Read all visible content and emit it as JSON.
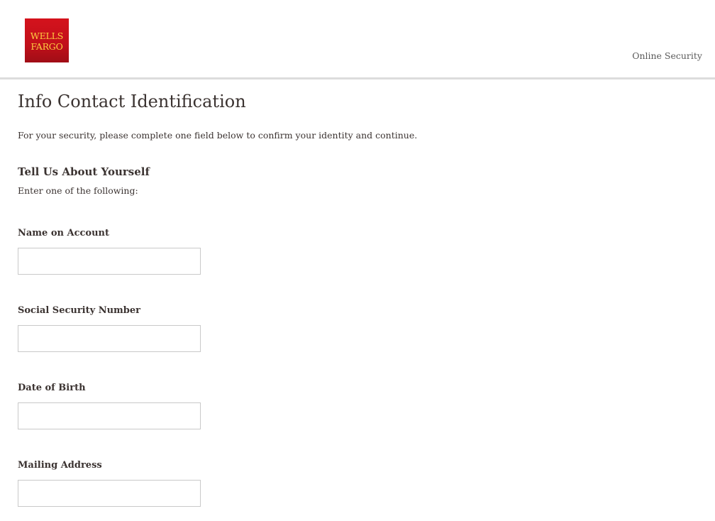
{
  "header": {
    "logo_line1": "WELLS",
    "logo_line2": "FARGO",
    "nav_link": "Online Security"
  },
  "page": {
    "title": "Info Contact Identification",
    "intro": "For your security, please complete one field below to confirm your identity and continue."
  },
  "section": {
    "heading": "Tell Us About Yourself",
    "subheading": "Enter one of the following:"
  },
  "fields": {
    "name_on_account": {
      "label": "Name on Account",
      "value": ""
    },
    "ssn": {
      "label": "Social Security Number",
      "value": ""
    },
    "dob": {
      "label": "Date of Birth",
      "value": ""
    },
    "mailing_address": {
      "label": "Mailing Address",
      "value": ""
    }
  },
  "colors": {
    "brand_red": "#d4121c",
    "brand_gold": "#ffcd41",
    "text": "#3b3331",
    "border": "#c9c9c9"
  }
}
